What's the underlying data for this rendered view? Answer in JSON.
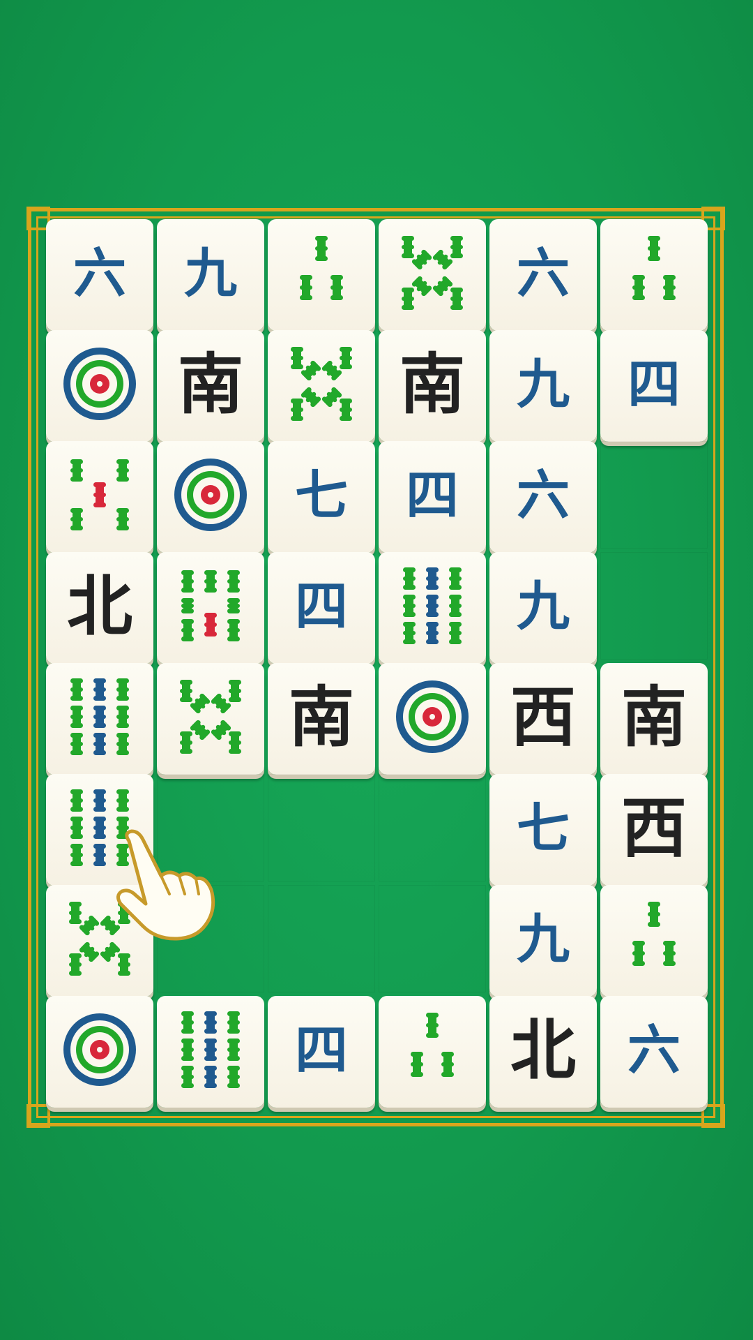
{
  "board": {
    "columns": 6,
    "rows": 8,
    "tiles": [
      [
        {
          "face": "六"
        },
        {
          "face": "九"
        },
        {
          "face": "bam3"
        },
        {
          "face": "bam8"
        },
        {
          "face": "六"
        },
        {
          "face": "bam3"
        }
      ],
      [
        {
          "face": "dot"
        },
        {
          "face": "南"
        },
        {
          "face": "bam8"
        },
        {
          "face": "南"
        },
        {
          "face": "九"
        },
        {
          "face": "四"
        }
      ],
      [
        {
          "face": "bam5"
        },
        {
          "face": "dot"
        },
        {
          "face": "七"
        },
        {
          "face": "四"
        },
        {
          "face": "六"
        },
        null
      ],
      [
        {
          "face": "北"
        },
        {
          "face": "bam7"
        },
        {
          "face": "四"
        },
        {
          "face": "bam9"
        },
        {
          "face": "九"
        },
        null
      ],
      [
        {
          "face": "bam9"
        },
        {
          "face": "bam8"
        },
        {
          "face": "南"
        },
        {
          "face": "dot"
        },
        {
          "face": "西"
        },
        {
          "face": "南"
        }
      ],
      [
        {
          "face": "bam9"
        },
        null,
        null,
        null,
        {
          "face": "七"
        },
        {
          "face": "西"
        }
      ],
      [
        {
          "face": "bam8"
        },
        null,
        null,
        null,
        {
          "face": "九"
        },
        {
          "face": "bam3"
        }
      ],
      [
        {
          "face": "dot"
        },
        {
          "face": "bam9"
        },
        {
          "face": "四"
        },
        {
          "face": "bam3"
        },
        {
          "face": "北"
        },
        {
          "face": "六"
        }
      ]
    ]
  },
  "tutorial": {
    "pointer": "hand-pointer-icon",
    "target_row": 5,
    "target_col": 0
  },
  "colors": {
    "felt": "#129a4e",
    "frame_gold": "#d8a51c",
    "tile_face": "#fbf8ee",
    "char_blue": "#1f5a8f",
    "wind_black": "#222222",
    "bamboo_green": "#22a82a",
    "dot_red": "#d8283a"
  }
}
